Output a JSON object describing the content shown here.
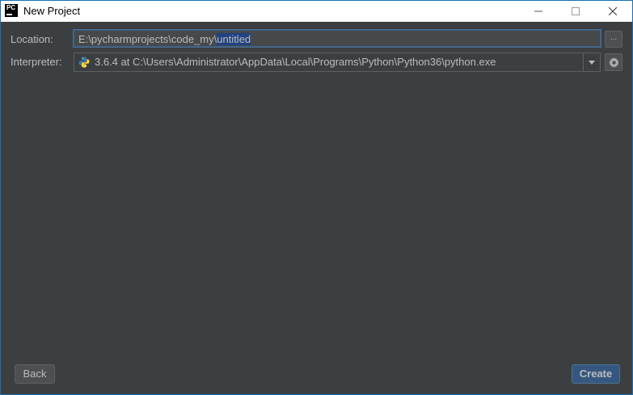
{
  "window": {
    "title": "New Project",
    "app_logo_text": "PC"
  },
  "form": {
    "location_label": "Location:",
    "location_prefix": "E:\\pycharmprojects\\code_my\\",
    "location_selected": "untitled",
    "browse_label": "...",
    "interpreter_label": "Interpreter:",
    "interpreter_value": "3.6.4 at C:\\Users\\Administrator\\AppData\\Local\\Programs\\Python\\Python36\\python.exe"
  },
  "footer": {
    "back_label": "Back",
    "create_label": "Create"
  },
  "colors": {
    "background": "#3c3f41",
    "text": "#bbbbbb",
    "selection": "#214283",
    "primary_button": "#365880"
  }
}
